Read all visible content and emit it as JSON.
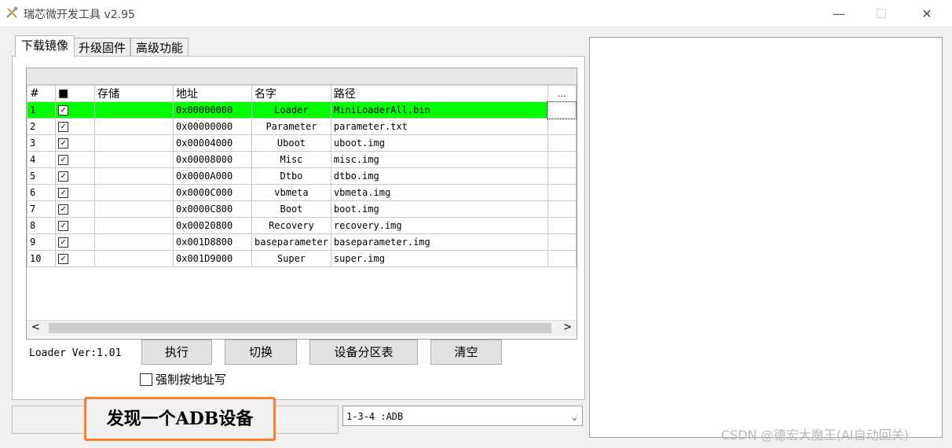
{
  "window": {
    "title": "瑞芯微开发工具 v2.95",
    "minimize": "—",
    "maximize": "☐",
    "close": "✕"
  },
  "tabs": [
    {
      "label": "下载镜像",
      "active": true
    },
    {
      "label": "升级固件",
      "active": false
    },
    {
      "label": "高级功能",
      "active": false
    }
  ],
  "table": {
    "headers": {
      "idx": "#",
      "check": "■",
      "storage": "存储",
      "address": "地址",
      "name": "名字",
      "path": "路径",
      "more": "..."
    },
    "rows": [
      {
        "idx": "1",
        "checked": true,
        "storage": "",
        "address": "0x00000000",
        "name": "Loader",
        "path": "MiniLoaderAll.bin",
        "selected": true
      },
      {
        "idx": "2",
        "checked": true,
        "storage": "",
        "address": "0x00000000",
        "name": "Parameter",
        "path": "parameter.txt"
      },
      {
        "idx": "3",
        "checked": true,
        "storage": "",
        "address": "0x00004000",
        "name": "Uboot",
        "path": "uboot.img"
      },
      {
        "idx": "4",
        "checked": true,
        "storage": "",
        "address": "0x00008000",
        "name": "Misc",
        "path": "misc.img"
      },
      {
        "idx": "5",
        "checked": true,
        "storage": "",
        "address": "0x0000A000",
        "name": "Dtbo",
        "path": "dtbo.img"
      },
      {
        "idx": "6",
        "checked": true,
        "storage": "",
        "address": "0x0000C000",
        "name": "vbmeta",
        "path": "vbmeta.img"
      },
      {
        "idx": "7",
        "checked": true,
        "storage": "",
        "address": "0x0000C800",
        "name": "Boot",
        "path": "boot.img"
      },
      {
        "idx": "8",
        "checked": true,
        "storage": "",
        "address": "0x00020800",
        "name": "Recovery",
        "path": "recovery.img"
      },
      {
        "idx": "9",
        "checked": true,
        "storage": "",
        "address": "0x001D8800",
        "name": "baseparameter",
        "path": "baseparameter.img"
      },
      {
        "idx": "10",
        "checked": true,
        "storage": "",
        "address": "0x001D9000",
        "name": "Super",
        "path": "super.img"
      }
    ],
    "scroll_left": "<",
    "scroll_right": ">"
  },
  "loader_ver": "Loader Ver:1.01",
  "buttons": {
    "run": "执行",
    "switch": "切换",
    "partition": "设备分区表",
    "clear": "清空"
  },
  "force_write_label": "强制按地址写",
  "status_text": "发现一个ADB设备",
  "device": "1-3-4 :ADB",
  "watermark": "CSDN @德宏大魔王(AI自动回关)",
  "colors": {
    "selected_row": "#00ff00",
    "highlight_border": "#ff7f27"
  }
}
